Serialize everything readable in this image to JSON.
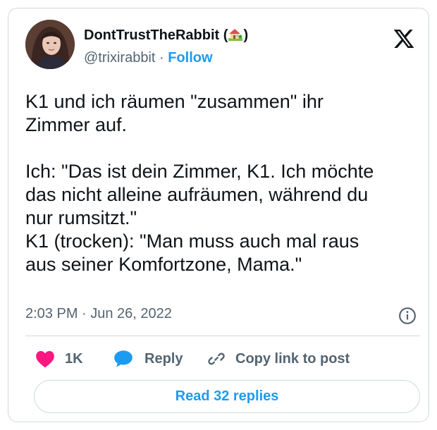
{
  "author": {
    "name": "DontTrustTheRabbit",
    "name_open": " (",
    "name_close": ")",
    "handle": "@trixirabbit",
    "separator": " · ",
    "follow_label": "Follow",
    "emoji_icon": "house-with-garden-icon"
  },
  "tweet": {
    "text": "K1 und ich räumen \"zusammen\" ihr\nZimmer auf.\n\nIch: \"Das ist dein Zimmer, K1. Ich möchte\ndas nicht alleine aufräumen, während du\nnur rumsitzt.\"\nK1 (trocken): \"Man muss auch mal raus\naus seiner Komfortzone, Mama.\"",
    "timestamp": "2:03 PM · Jun 26, 2022"
  },
  "actions": {
    "likes_count": "1K",
    "reply_label": "Reply",
    "copy_label": "Copy link to post"
  },
  "read_replies_label": "Read 32 replies",
  "colors": {
    "accent": "#1d9bf0",
    "like": "#f91880",
    "text": "#0f1419",
    "muted": "#536471",
    "border": "#cfd9de"
  }
}
